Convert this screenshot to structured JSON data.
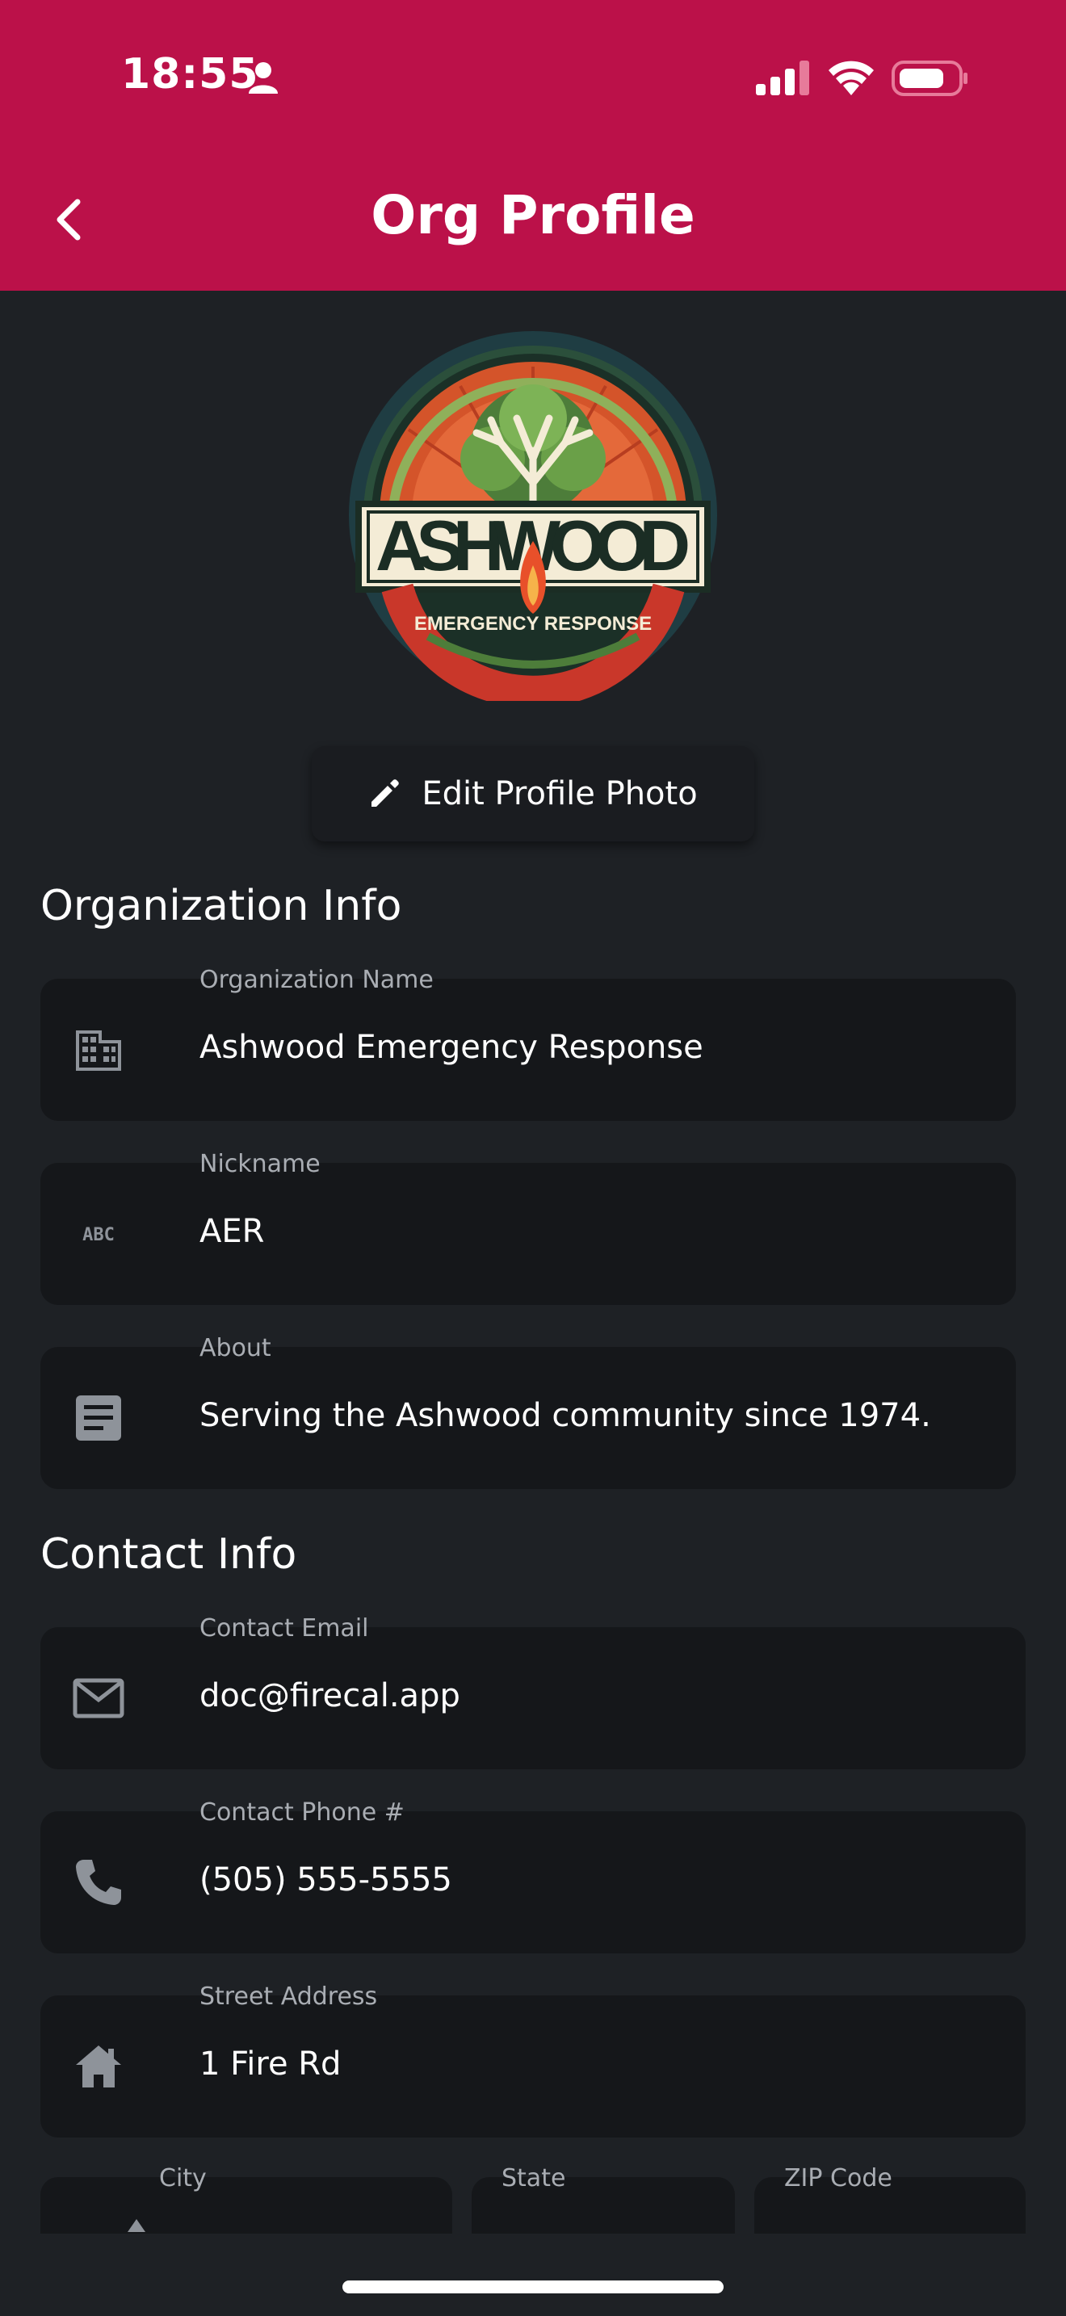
{
  "status_bar": {
    "time": "18:55"
  },
  "header": {
    "title": "Org Profile",
    "background": "#bb1149"
  },
  "logo": {
    "brand_text": "ASHWOOD",
    "tagline": "EMERGENCY RESPONSE"
  },
  "edit_photo": {
    "label": "Edit Profile Photo"
  },
  "sections": {
    "organization_info": "Organization Info",
    "contact_info": "Contact Info"
  },
  "org_fields": {
    "name": {
      "label": "Organization Name",
      "value": "Ashwood Emergency Response",
      "icon": "building-icon"
    },
    "nickname": {
      "label": "Nickname",
      "value": "AER",
      "icon": "abc-icon"
    },
    "about": {
      "label": "About",
      "value": "Serving the Ashwood community since 1974.",
      "icon": "article-icon"
    }
  },
  "contact_fields": {
    "email": {
      "label": "Contact Email",
      "value": "doc@firecal.app",
      "icon": "email-icon"
    },
    "phone": {
      "label": "Contact Phone #",
      "value": "(505) 555-5555",
      "icon": "phone-icon"
    },
    "street": {
      "label": "Street Address",
      "value": "1 Fire Rd",
      "icon": "home-icon"
    },
    "city": {
      "label": "City"
    },
    "state": {
      "label": "State"
    },
    "zip": {
      "label": "ZIP Code"
    }
  }
}
